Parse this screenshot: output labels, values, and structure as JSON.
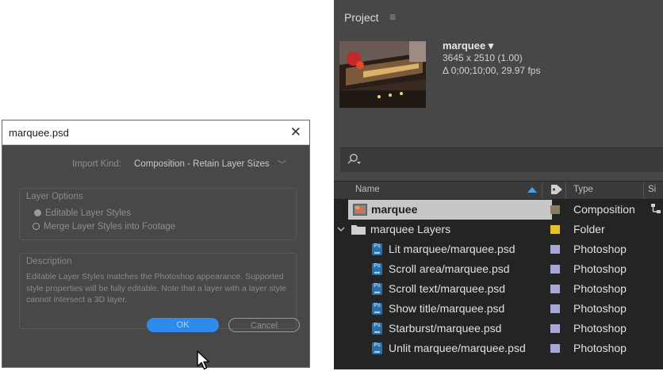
{
  "dialog": {
    "title": "marquee.psd",
    "close_glyph": "✕",
    "import_kind_label": "Import Kind:",
    "import_kind_value": "Composition - Retain Layer Sizes",
    "layer_options_title": "Layer Options",
    "option_editable": "Editable Layer Styles",
    "option_merge": "Merge Layer Styles into Footage",
    "selected_option": "Editable Layer Styles",
    "description_title": "Description",
    "description_text": "Editable Layer Styles matches the Photoshop appearance. Supported style properties will be fully editable. Note that a layer with a layer style cannot intersect a 3D layer.",
    "ok_label": "OK",
    "cancel_label": "Cancel"
  },
  "project": {
    "panel_title": "Project",
    "menu_glyph": "≡",
    "asset_name": "marquee ▾",
    "asset_dims": "3645 x 2510 (1.00)",
    "asset_duration": "Δ 0;00;10;00, 29.97 fps",
    "search_icon": "search-icon",
    "columns": {
      "name": "Name",
      "type": "Type",
      "size": "Si"
    },
    "colors": {
      "composition_label": "#8a7a62",
      "folder_label": "#e6c229",
      "photoshop_label": "#a8a8d8",
      "selection": "#c7c7c7"
    },
    "rows": [
      {
        "name": "marquee",
        "type": "Composition",
        "icon": "composition-icon"
      },
      {
        "name": "marquee Layers",
        "type": "Folder",
        "icon": "folder-icon"
      },
      {
        "name": "Lit marquee/marquee.psd",
        "type": "Photoshop",
        "icon": "photoshop-file-icon"
      },
      {
        "name": "Scroll area/marquee.psd",
        "type": "Photoshop",
        "icon": "photoshop-file-icon"
      },
      {
        "name": "Scroll text/marquee.psd",
        "type": "Photoshop",
        "icon": "photoshop-file-icon"
      },
      {
        "name": "Show title/marquee.psd",
        "type": "Photoshop",
        "icon": "photoshop-file-icon"
      },
      {
        "name": "Starburst/marquee.psd",
        "type": "Photoshop",
        "icon": "photoshop-file-icon"
      },
      {
        "name": "Unlit marquee/marquee.psd",
        "type": "Photoshop",
        "icon": "photoshop-file-icon"
      }
    ]
  }
}
